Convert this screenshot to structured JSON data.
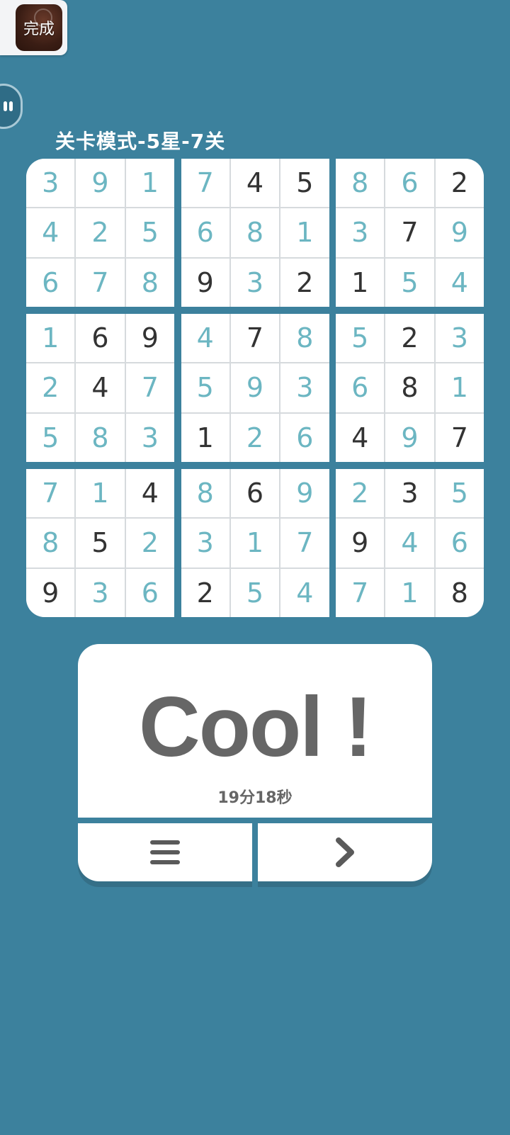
{
  "overlay": {
    "done_label": "完成"
  },
  "level": {
    "title": "关卡模式-5星-7关"
  },
  "board": {
    "boxes": [
      [
        3,
        9,
        1,
        4,
        2,
        5,
        6,
        7,
        8
      ],
      [
        7,
        4,
        5,
        6,
        8,
        1,
        9,
        3,
        2
      ],
      [
        8,
        6,
        2,
        3,
        7,
        9,
        1,
        5,
        4
      ],
      [
        1,
        6,
        9,
        2,
        4,
        7,
        5,
        8,
        3
      ],
      [
        4,
        7,
        8,
        5,
        9,
        3,
        1,
        2,
        6
      ],
      [
        5,
        2,
        3,
        6,
        8,
        1,
        4,
        9,
        7
      ],
      [
        7,
        1,
        4,
        8,
        5,
        2,
        9,
        3,
        6
      ],
      [
        8,
        6,
        9,
        3,
        1,
        7,
        2,
        5,
        4
      ],
      [
        2,
        3,
        5,
        9,
        4,
        6,
        7,
        1,
        8
      ]
    ],
    "given_mask": [
      [
        0,
        0,
        0,
        0,
        0,
        0,
        0,
        0,
        0
      ],
      [
        0,
        1,
        1,
        0,
        0,
        0,
        1,
        0,
        1
      ],
      [
        0,
        0,
        1,
        0,
        1,
        0,
        1,
        0,
        0
      ],
      [
        0,
        1,
        1,
        0,
        1,
        0,
        0,
        0,
        0
      ],
      [
        0,
        1,
        0,
        0,
        0,
        0,
        1,
        0,
        0
      ],
      [
        0,
        1,
        0,
        0,
        1,
        0,
        1,
        0,
        1
      ],
      [
        0,
        0,
        1,
        0,
        1,
        0,
        1,
        0,
        0
      ],
      [
        0,
        1,
        0,
        0,
        0,
        0,
        1,
        0,
        0
      ],
      [
        0,
        1,
        0,
        1,
        0,
        0,
        0,
        0,
        1
      ]
    ],
    "colors": {
      "given": "#333333",
      "filled": "#6cb6c2",
      "background": "#3c819d"
    }
  },
  "result": {
    "title": "Cool !",
    "time": "19分18秒"
  },
  "buttons": {
    "menu_icon": "menu-icon",
    "next_icon": "chevron-right-icon"
  }
}
